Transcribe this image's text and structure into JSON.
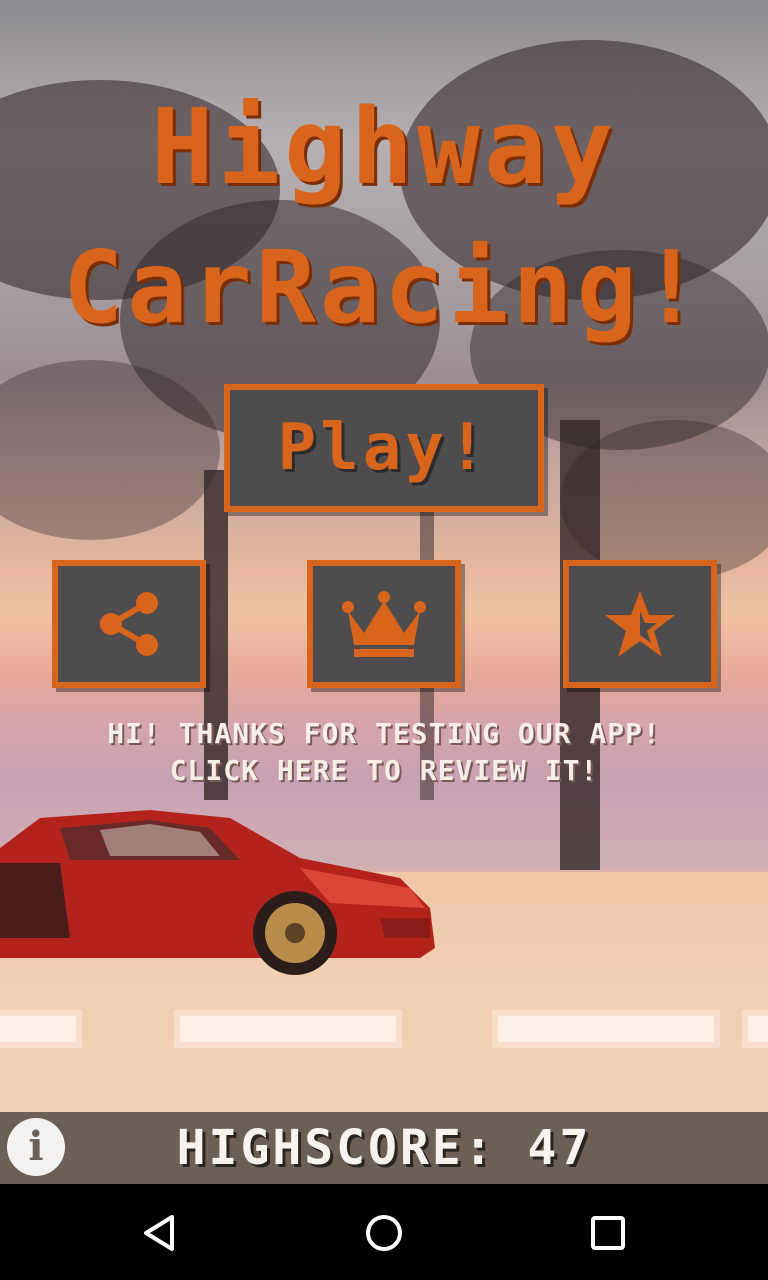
{
  "title": {
    "line1": "Highway",
    "line2": "CarRacing!"
  },
  "play_button": {
    "label": "Play!"
  },
  "icons": {
    "share": "share-icon",
    "leaderboard": "crown-icon",
    "rate": "star-icon",
    "info": "info-icon"
  },
  "message": {
    "line1": "HI! THANKS FOR TESTING OUR APP!",
    "line2": "CLICK HERE TO REVIEW IT!"
  },
  "highscore": {
    "text": "HIGHSCORE: 47"
  },
  "navbar": {
    "back": "back-icon",
    "home": "home-icon",
    "recent": "recent-apps-icon"
  },
  "colors": {
    "accent": "#d9641c",
    "button_bg": "#4e4c4d",
    "bottom_bar": "#6b5f56"
  }
}
